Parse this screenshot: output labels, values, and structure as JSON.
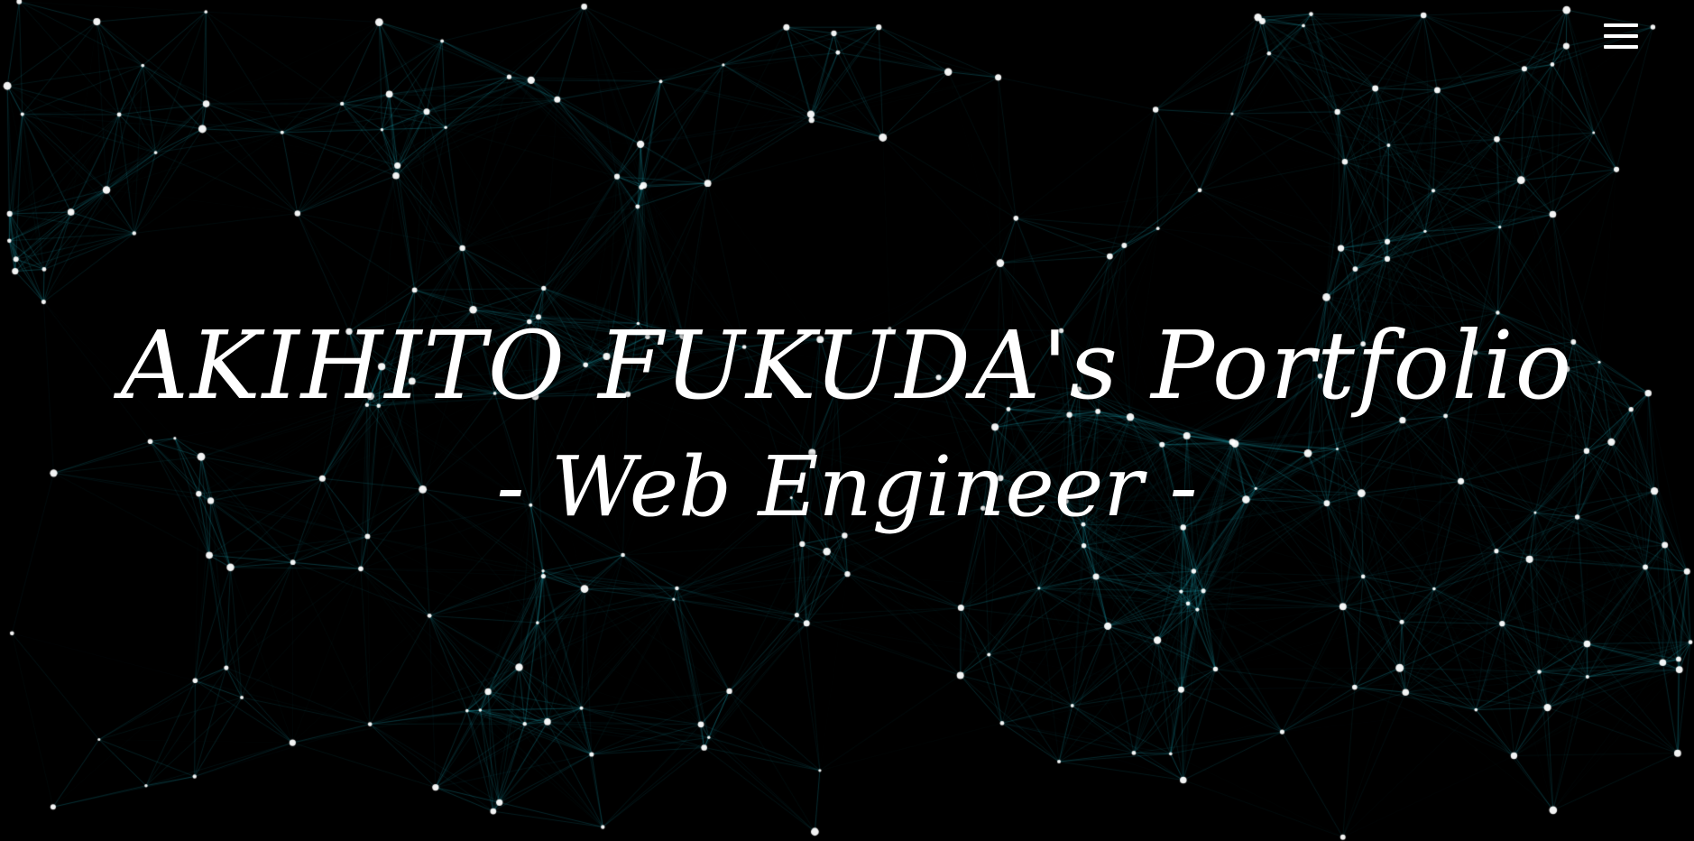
{
  "hero": {
    "title": "AKIHITO FUKUDA's Portfolio",
    "subtitle": "- Web Engineer -"
  },
  "menu": {
    "icon": "hamburger-menu-icon"
  },
  "colors": {
    "background": "#000000",
    "network_line": "#1aa7b8",
    "node": "#ffffff",
    "text": "#ffffff"
  }
}
